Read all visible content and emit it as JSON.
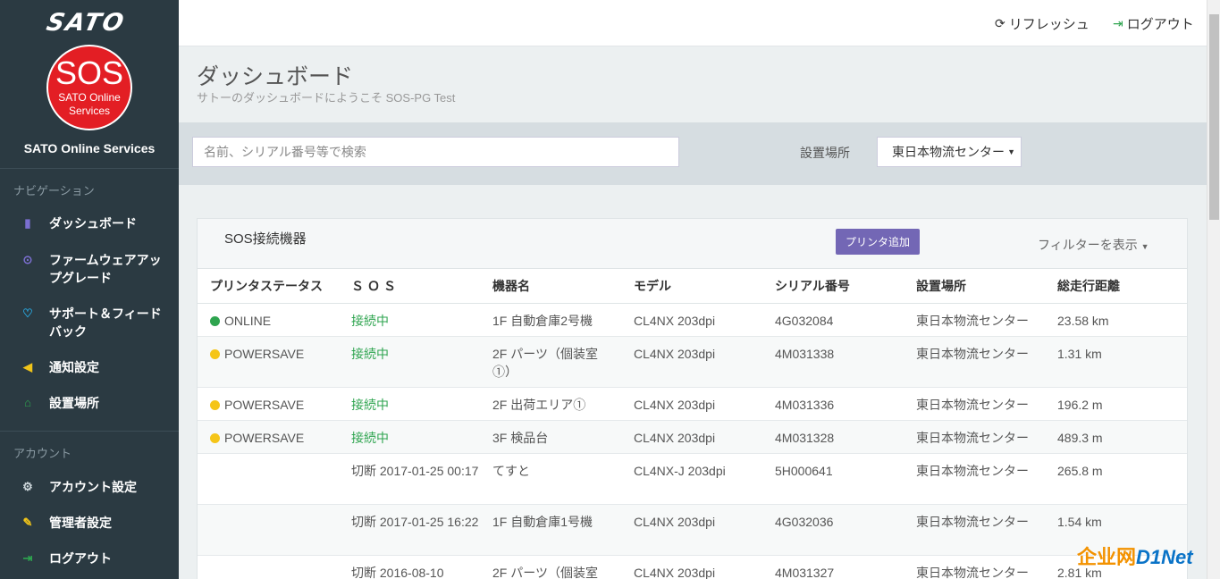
{
  "brand": {
    "logo_text": "SATO",
    "sos_big": "SOS",
    "sos_line1": "SATO Online",
    "sos_line2": "Services",
    "service_name": "SATO Online Services"
  },
  "sidebar": {
    "nav_section": "ナビゲーション",
    "nav_items": [
      {
        "label": "ダッシュボード",
        "icon": "bar-chart-icon",
        "color": "#7b6fd0"
      },
      {
        "label": "ファームウェアアップグレード",
        "icon": "upload-circle-icon",
        "color": "#7b6fd0"
      },
      {
        "label": "サポート＆フィードバック",
        "icon": "heart-icon",
        "color": "#29a8e0"
      },
      {
        "label": "通知設定",
        "icon": "megaphone-icon",
        "color": "#f0c419"
      },
      {
        "label": "設置場所",
        "icon": "home-icon",
        "color": "#2ea44f"
      }
    ],
    "account_section": "アカウント",
    "account_items": [
      {
        "label": "アカウント設定",
        "icon": "gear-icon",
        "color": "#cfd8dc"
      },
      {
        "label": "管理者設定",
        "icon": "wrench-icon",
        "color": "#f0c419"
      },
      {
        "label": "ログアウト",
        "icon": "logout-icon",
        "color": "#2ea44f"
      }
    ]
  },
  "topbar": {
    "refresh": "リフレッシュ",
    "logout": "ログアウト"
  },
  "header": {
    "title": "ダッシュボード",
    "subtitle": "サトーのダッシュボードにようこそ SOS-PG Test"
  },
  "search": {
    "placeholder": "名前、シリアル番号等で検索",
    "location_label": "設置場所",
    "location_value": "東日本物流センター"
  },
  "panel": {
    "title": "SOS接続機器",
    "add_button": "プリンタ追加",
    "filter": "フィルターを表示",
    "columns": [
      "プリンタステータス",
      "ＳＯＳ",
      "機器名",
      "モデル",
      "シリアル番号",
      "設置場所",
      "総走行距離"
    ],
    "rows": [
      {
        "status": "ONLINE",
        "status_color": "#2ea44f",
        "sos": "接続中",
        "sos_connected": true,
        "name": "1F 自動倉庫2号機",
        "model": "CL4NX 203dpi",
        "serial": "4G032084",
        "location": "東日本物流センター",
        "distance": "23.58 km"
      },
      {
        "status": "POWERSAVE",
        "status_color": "#f5c518",
        "sos": "接続中",
        "sos_connected": true,
        "name": "2F パーツ（個装室①）",
        "model": "CL4NX 203dpi",
        "serial": "4M031338",
        "location": "東日本物流センター",
        "distance": "1.31 km"
      },
      {
        "status": "POWERSAVE",
        "status_color": "#f5c518",
        "sos": "接続中",
        "sos_connected": true,
        "name": "2F 出荷エリア①",
        "model": "CL4NX 203dpi",
        "serial": "4M031336",
        "location": "東日本物流センター",
        "distance": "196.2 m"
      },
      {
        "status": "POWERSAVE",
        "status_color": "#f5c518",
        "sos": "接続中",
        "sos_connected": true,
        "name": "3F 検品台",
        "model": "CL4NX 203dpi",
        "serial": "4M031328",
        "location": "東日本物流センター",
        "distance": "489.3 m"
      },
      {
        "status": "",
        "status_color": "",
        "sos": "切断 2017-01-25 00:17",
        "sos_connected": false,
        "name": "てすと",
        "model": "CL4NX-J 203dpi",
        "serial": "5H000641",
        "location": "東日本物流センター",
        "distance": "265.8 m"
      },
      {
        "status": "",
        "status_color": "",
        "sos": "切断 2017-01-25 16:22",
        "sos_connected": false,
        "name": "1F 自動倉庫1号機",
        "model": "CL4NX 203dpi",
        "serial": "4G032036",
        "location": "東日本物流センター",
        "distance": "1.54 km"
      },
      {
        "status": "",
        "status_color": "",
        "sos": "切断 2016-08-10",
        "sos_connected": false,
        "name": "2F パーツ（個装室",
        "model": "CL4NX 203dpi",
        "serial": "4M031327",
        "location": "東日本物流センター",
        "distance": "2.81 km"
      }
    ]
  },
  "watermark": {
    "text_a": "企业网",
    "text_b": "D1Net"
  }
}
